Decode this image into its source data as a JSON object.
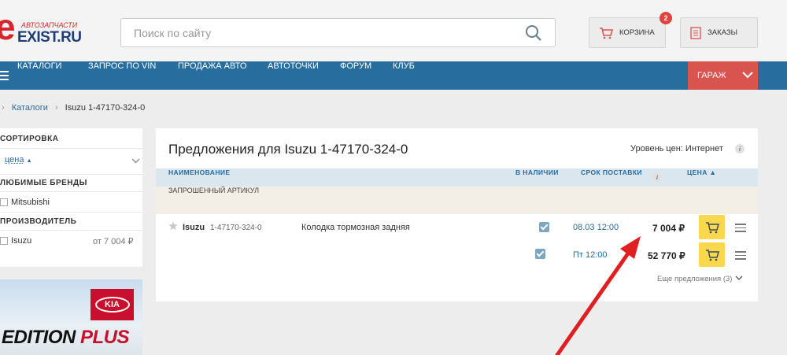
{
  "header": {
    "logo_small": "АВТОЗАПЧАСТИ",
    "logo_letter": "e",
    "logo_big": "EXIST.RU",
    "search_placeholder": "Поиск по сайту",
    "cart_label": "КОРЗИНА",
    "cart_count": "2",
    "orders_label": "ЗАКАЗЫ"
  },
  "nav": {
    "items": [
      "КАТАЛОГИ",
      "ЗАПРОС ПО VIN",
      "ПРОДАЖА АВТО",
      "АВТОТОЧКИ",
      "ФОРУМ",
      "КЛУБ"
    ],
    "garage": "ГАРАЖ"
  },
  "breadcrumb": [
    "Каталоги",
    "Isuzu 1-47170-324-0"
  ],
  "sidebar": {
    "sort_title": "СОРТИРОВКА",
    "sort_value": "цена",
    "sort_dir": "▲",
    "fav_title": "ЛЮБИМЫЕ БРЕНДЫ",
    "fav_brand": "Mitsubishi",
    "maker_title": "ПРОИЗВОДИТЕЛЬ",
    "maker": "Isuzu",
    "maker_price": "от 7 004 ₽"
  },
  "banner": {
    "brand": "KIA",
    "text_a": "EDITION",
    "text_b": "PLUS"
  },
  "panel": {
    "title": "Предложения для  Isuzu 1-47170-324-0",
    "price_level": "Уровень цен: Интернет",
    "columns": {
      "name": "НАИМЕНОВАНИЕ",
      "stock": "В НАЛИЧИИ",
      "delivery": "СРОК ПОСТАВКИ",
      "price": "ЦЕНА ▲"
    },
    "section": "ЗАПРОШЕННЫЙ АРТИКУЛ",
    "offer": {
      "brand": "Isuzu",
      "article": "1-47170-324-0",
      "description": "Колодка тормозная задняя"
    },
    "rows": [
      {
        "delivery": "08.03 12:00",
        "price": "7 004 ₽"
      },
      {
        "delivery": "Пт 12:00",
        "price": "52 770 ₽"
      }
    ],
    "more": "Еще предложения (3)"
  },
  "colors": {
    "nav": "#276e9e",
    "garage": "#d9534f",
    "buy": "#f9d84d",
    "arrow": "#e02020"
  }
}
